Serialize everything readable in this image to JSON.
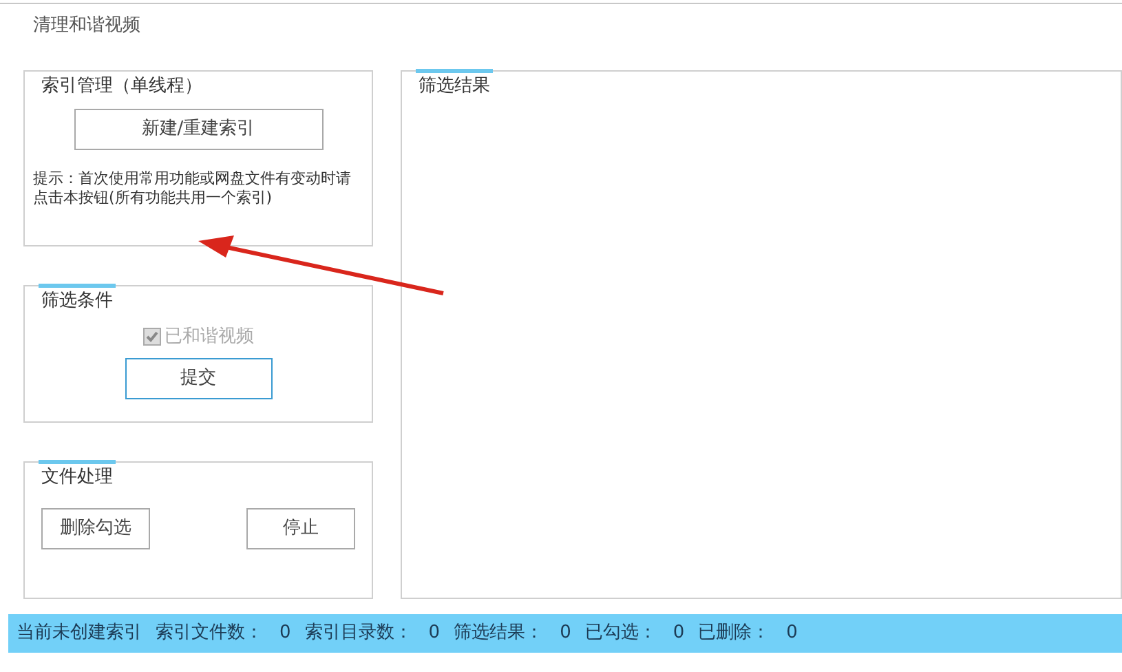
{
  "window": {
    "title": "清理和谐视频"
  },
  "index_group": {
    "title": "索引管理（单线程）",
    "button": "新建/重建索引",
    "hint": "提示：首次使用常用功能或网盘文件有变动时请点击本按钮(所有功能共用一个索引)"
  },
  "filter_group": {
    "title": "筛选条件",
    "checkbox": {
      "label": "已和谐视频",
      "checked": true,
      "disabled": true
    },
    "button": "提交"
  },
  "file_group": {
    "title": "文件处理",
    "buttons": [
      "删除勾选",
      "停止"
    ]
  },
  "results": {
    "title": "筛选结果"
  },
  "status_bar": {
    "message": "当前未创建索引",
    "stats": [
      {
        "label": "索引文件数：",
        "value": "0"
      },
      {
        "label": "索引目录数：",
        "value": "0"
      },
      {
        "label": "筛选结果：",
        "value": "0"
      },
      {
        "label": "已勾选：",
        "value": "0"
      },
      {
        "label": "已删除：",
        "value": "0"
      }
    ]
  }
}
